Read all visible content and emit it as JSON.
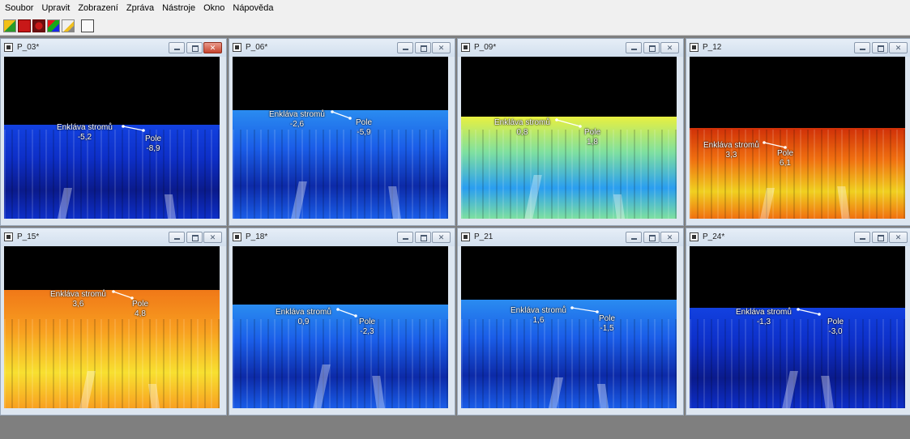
{
  "menu": [
    "Soubor",
    "Upravit",
    "Zobrazení",
    "Zpráva",
    "Nástroje",
    "Okno",
    "Nápověda"
  ],
  "toolbar_icons": [
    "open-icon",
    "save-icon",
    "record-icon",
    "palette-icon",
    "edit-icon",
    "print-icon"
  ],
  "windows": [
    {
      "title": "P_03*",
      "label_a": "Enkláva stromů",
      "value_a": "-5,2",
      "label_b": "Pole",
      "value_b": "-8,9",
      "palette": "deep-blue",
      "active": true
    },
    {
      "title": "P_06*",
      "label_a": "Enkláva stromů",
      "value_a": "-2,6",
      "label_b": "Pole",
      "value_b": "-5,9",
      "palette": "blue",
      "active": false
    },
    {
      "title": "P_09*",
      "label_a": "Enkláva stromů",
      "value_a": "0,8",
      "label_b": "Pole",
      "value_b": "1,8",
      "palette": "cyan-yellow",
      "active": false
    },
    {
      "title": "P_12",
      "label_a": "Enkláva stromů",
      "value_a": "3,3",
      "label_b": "Pole",
      "value_b": "6,1",
      "palette": "orange-red",
      "active": false
    },
    {
      "title": "P_15*",
      "label_a": "Enkláva stromů",
      "value_a": "3,6",
      "label_b": "Pole",
      "value_b": "4,8",
      "palette": "yellow-orange",
      "active": false
    },
    {
      "title": "P_18*",
      "label_a": "Enkláva stromů",
      "value_a": "0,9",
      "label_b": "Pole",
      "value_b": "-2,3",
      "palette": "blue",
      "active": false
    },
    {
      "title": "P_21",
      "label_a": "Enkláva stromů",
      "value_a": "1,6",
      "label_b": "Pole",
      "value_b": "-1,5",
      "palette": "blue",
      "active": false
    },
    {
      "title": "P_24*",
      "label_a": "Enkláva stromů",
      "value_a": "-1,3",
      "label_b": "Pole",
      "value_b": "-3,0",
      "palette": "deep-blue",
      "active": false
    }
  ],
  "colors": {
    "deep-blue": [
      "#0a1a8c",
      "#0d2fc8",
      "#1241e0"
    ],
    "blue": [
      "#0c2aa8",
      "#1a5de8",
      "#2a8cf0"
    ],
    "cyan-yellow": [
      "#2a9ef0",
      "#7ee0a0",
      "#e8f040"
    ],
    "orange-red": [
      "#f0d020",
      "#f07010",
      "#d03008"
    ],
    "yellow-orange": [
      "#f8e030",
      "#f8a020",
      "#f07818"
    ]
  }
}
